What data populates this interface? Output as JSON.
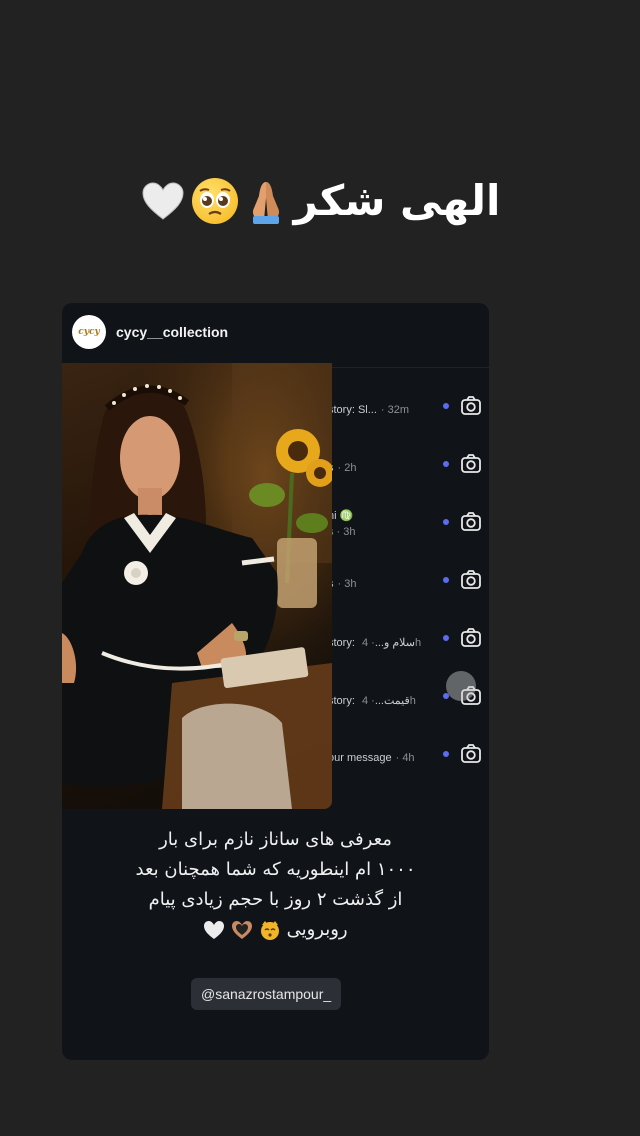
{
  "story": {
    "caption": "الهی شکر",
    "caption_emojis": [
      "pray-emoji",
      "pleading-face-emoji",
      "white-heart-emoji"
    ]
  },
  "post": {
    "username": "cycy__collection",
    "avatar_text": "cycy",
    "dm_rows": [
      {
        "text": "story: Sl...",
        "time": "· 32m"
      },
      {
        "text": "s",
        "time": "· 2h"
      },
      {
        "text": "ni ♍",
        "time": "s · 3h"
      },
      {
        "text": "s",
        "time": "· 3h"
      },
      {
        "text": "story: سلام و...",
        "time": "· 4h"
      },
      {
        "text": "story: قیمت...",
        "time": "· 4h"
      },
      {
        "text": "our message",
        "time": "· 4h"
      }
    ],
    "body_lines": [
      "معرفی های ساناز نازم برای بار",
      "۱۰۰۰ ام اینطوریه که شما همچنان بعد",
      "از گذشت ۲ روز با حجم زیادی پیام",
      "روبرویی"
    ],
    "body_emojis": [
      "kissing-cat-emoji",
      "heart-hands-emoji",
      "white-heart-emoji"
    ],
    "mention": "@sanazrostampour_"
  },
  "colors": {
    "background": "#222222",
    "card": "#101418",
    "unread_dot": "#5b6cf0",
    "mention_bg": "#2c3036"
  }
}
